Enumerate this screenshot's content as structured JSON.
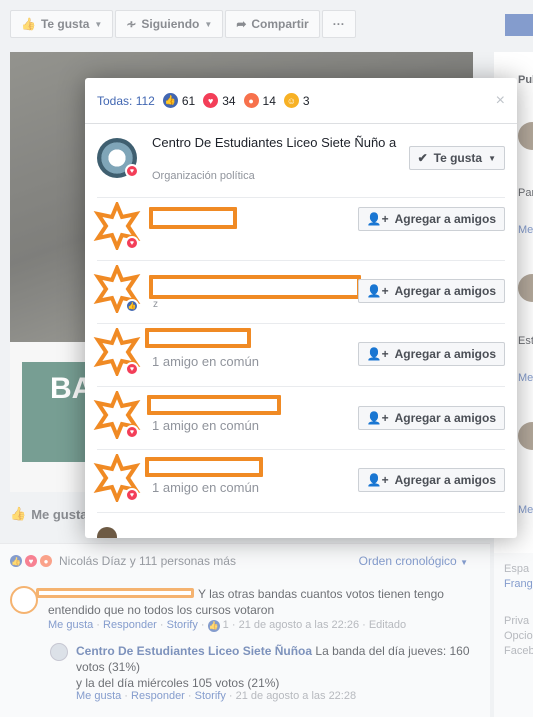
{
  "topbar": {
    "like_label": "Te gusta",
    "follow_label": "Siguiendo",
    "share_label": "Compartir",
    "more_label": "···"
  },
  "cover": {
    "banner_text": "BA"
  },
  "like_row": {
    "label": "Me gusta"
  },
  "right_col": {
    "header": "Publi",
    "items": [
      "Par",
      "Me",
      "Est",
      "Me",
      "Me"
    ]
  },
  "modal": {
    "tabs": {
      "all": "Todas: 112",
      "like_count": "61",
      "love_count": "34",
      "angry_count": "14",
      "haha_count": "3"
    },
    "close_label": "×",
    "page": {
      "name": "Centro De Estudiantes Liceo Siete Ñuño a",
      "category": "Organización política",
      "liked_label": "Te gusta"
    },
    "people": [
      {
        "reaction": "love",
        "mutual": "",
        "button": "Agregar a amigos"
      },
      {
        "reaction": "like",
        "mutual": "",
        "button": "Agregar a amigos"
      },
      {
        "reaction": "love",
        "mutual": "1 amigo en común",
        "button": "Agregar a amigos"
      },
      {
        "reaction": "love",
        "mutual": "1 amigo en común",
        "button": "Agregar a amigos"
      },
      {
        "reaction": "love",
        "mutual": "1 amigo en común",
        "button": "Agregar a amigos"
      }
    ],
    "stray_char": "z"
  },
  "comments": {
    "reaction_summary": "Nicolás Díaz y 111 personas más",
    "sort_label": "Orden cronológico",
    "main": {
      "text": "Y las otras bandas cuantos votos tienen tengo entendido que no todos los cursos votaron",
      "like": "Me gusta",
      "reply": "Responder",
      "storify": "Storify",
      "reply_count": "1",
      "time": "21 de agosto a las 22:26",
      "edited": "Editado"
    },
    "reply": {
      "author": "Centro De Estudiantes Liceo Siete Ñuñoa",
      "line1": "La banda del día jueves: 160 votos (31%)",
      "line2": "y la del día miércoles 105 votos (21%)",
      "like": "Me gusta",
      "reply": "Responder",
      "storify": "Storify",
      "time": "21 de agosto a las 22:28"
    }
  },
  "side_box": {
    "line1": "Espa",
    "line2": "Frang",
    "line3": "Priva",
    "line4": "Opcio",
    "line5": "Faceb"
  },
  "colors": {
    "fb_blue": "#4267b2",
    "redaction_orange": "#f08a24",
    "love_red": "#f33e58",
    "angry_orange": "#f7714c",
    "haha_yellow": "#f7b125"
  }
}
